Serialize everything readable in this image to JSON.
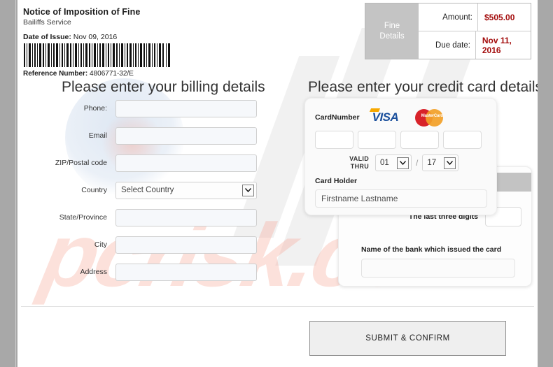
{
  "header": {
    "title": "Notice of Imposition of Fine",
    "subtitle": "Bailiffs Service",
    "date_label": "Date of Issue:",
    "date_value": "Nov 09, 2016",
    "reference_label": "Reference Number:",
    "reference_value": "4806771-32/E"
  },
  "fine_details": {
    "panel_label": "Fine\nDetails",
    "panel_label_line1": "Fine",
    "panel_label_line2": "Details",
    "rows": [
      {
        "label": "Amount:",
        "value": "$505.00"
      },
      {
        "label": "Due date:",
        "value": "Nov 11, 2016"
      }
    ],
    "value_color": "#a30c0c",
    "label_cell_color": "#c4c4c4"
  },
  "billing": {
    "title": "Please enter your billing details",
    "fields": [
      {
        "label": "Phone:",
        "type": "text",
        "value": "",
        "placeholder": ""
      },
      {
        "label": "Email",
        "type": "text",
        "value": "",
        "placeholder": ""
      },
      {
        "label": "ZIP/Postal code",
        "type": "text",
        "value": "",
        "placeholder": ""
      },
      {
        "label": "Country",
        "type": "select",
        "value": "Select Country",
        "placeholder": ""
      },
      {
        "label": "State/Province",
        "type": "text",
        "value": "",
        "placeholder": ""
      },
      {
        "label": "City",
        "type": "text",
        "value": "",
        "placeholder": ""
      },
      {
        "label": "Address",
        "type": "text",
        "value": "",
        "placeholder": ""
      }
    ]
  },
  "credit_card": {
    "title": "Please enter your credit card details",
    "card_number_label": "CardNumber",
    "visa_logo_text": "VISA",
    "mastercard_logo_text": "MasterCard",
    "card_number_groups": [
      "",
      "",
      "",
      ""
    ],
    "valid_thru_label_line1": "VALID",
    "valid_thru_label_line2": "THRU",
    "expiry_month": "01",
    "expiry_year": "17",
    "expiry_separator": "/",
    "card_holder_label": "Card Holder",
    "card_holder_placeholder": "Firstname Lastname",
    "card_holder_value": "",
    "cvv_label": "The last three digits",
    "cvv_value": "",
    "bank_label": "Name of the bank which issued the card",
    "bank_value": ""
  },
  "footer": {
    "submit_label": "SUBMIT & CONFIRM"
  },
  "watermark": {
    "text": "pcrisk.com"
  }
}
